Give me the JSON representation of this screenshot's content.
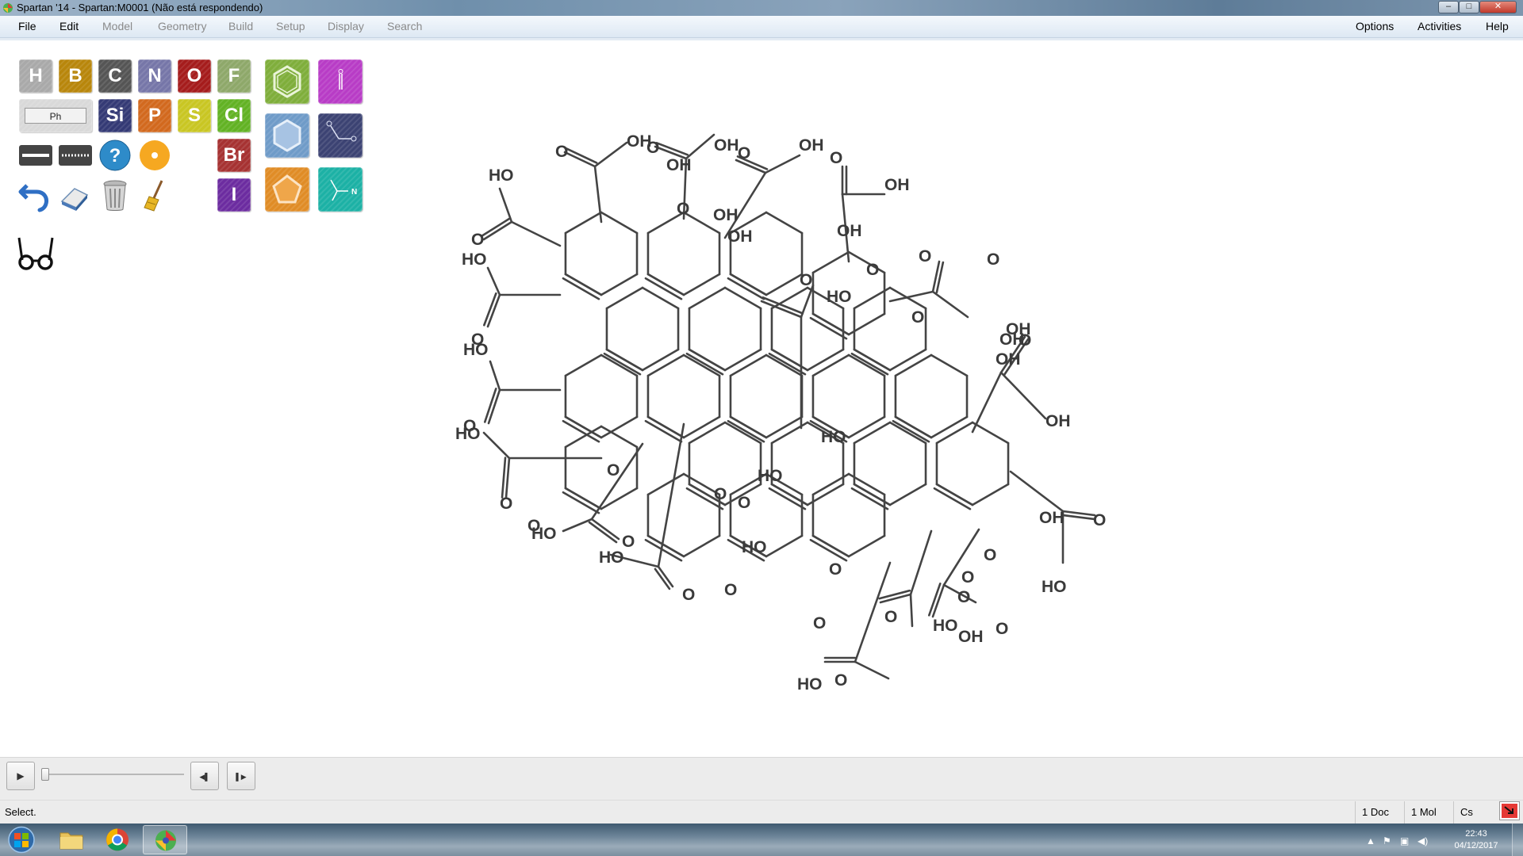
{
  "window": {
    "title": "Spartan '14 - Spartan:M0001 (Não está respondendo)"
  },
  "menu": {
    "left": [
      "File",
      "Edit",
      "Model",
      "Geometry",
      "Build",
      "Setup",
      "Display",
      "Search"
    ],
    "right": [
      "Options",
      "Activities",
      "Help"
    ]
  },
  "palette": {
    "elements": [
      {
        "symbol": "H",
        "color": "#a9a9a9"
      },
      {
        "symbol": "B",
        "color": "#b8860b"
      },
      {
        "symbol": "C",
        "color": "#555555"
      },
      {
        "symbol": "N",
        "color": "#7676a8"
      },
      {
        "symbol": "O",
        "color": "#a51c1c"
      },
      {
        "symbol": "F",
        "color": "#8ea86a"
      },
      {
        "symbol": "Ph",
        "color": "#d9d9d9"
      },
      {
        "symbol": "Si",
        "color": "#343a75"
      },
      {
        "symbol": "P",
        "color": "#d2691e"
      },
      {
        "symbol": "S",
        "color": "#c9c623"
      },
      {
        "symbol": "Cl",
        "color": "#62b224"
      },
      {
        "symbol": "Br",
        "color": "#a63232"
      },
      {
        "symbol": "I",
        "color": "#6c2ca0"
      }
    ],
    "fragment_colors": {
      "benzene": "#7fae3b",
      "cyclohexane": "#6f9bc8",
      "cyclopentane": "#e08c26",
      "carboxyl": "#3c4373",
      "amide": "#1cb1a5",
      "magenta_group": "#b83cc6"
    }
  },
  "molecule_labels": {
    "OH": "OH",
    "HO": "HO",
    "O": "O"
  },
  "playback": {
    "play": "▶",
    "prev": "◀▌",
    "next": "▌▶"
  },
  "status": {
    "message": "Select.",
    "docs": "1 Doc",
    "mols": "1 Mol",
    "symmetry": "Cs"
  },
  "taskbar": {
    "time": "22:43",
    "date": "04/12/2017"
  }
}
